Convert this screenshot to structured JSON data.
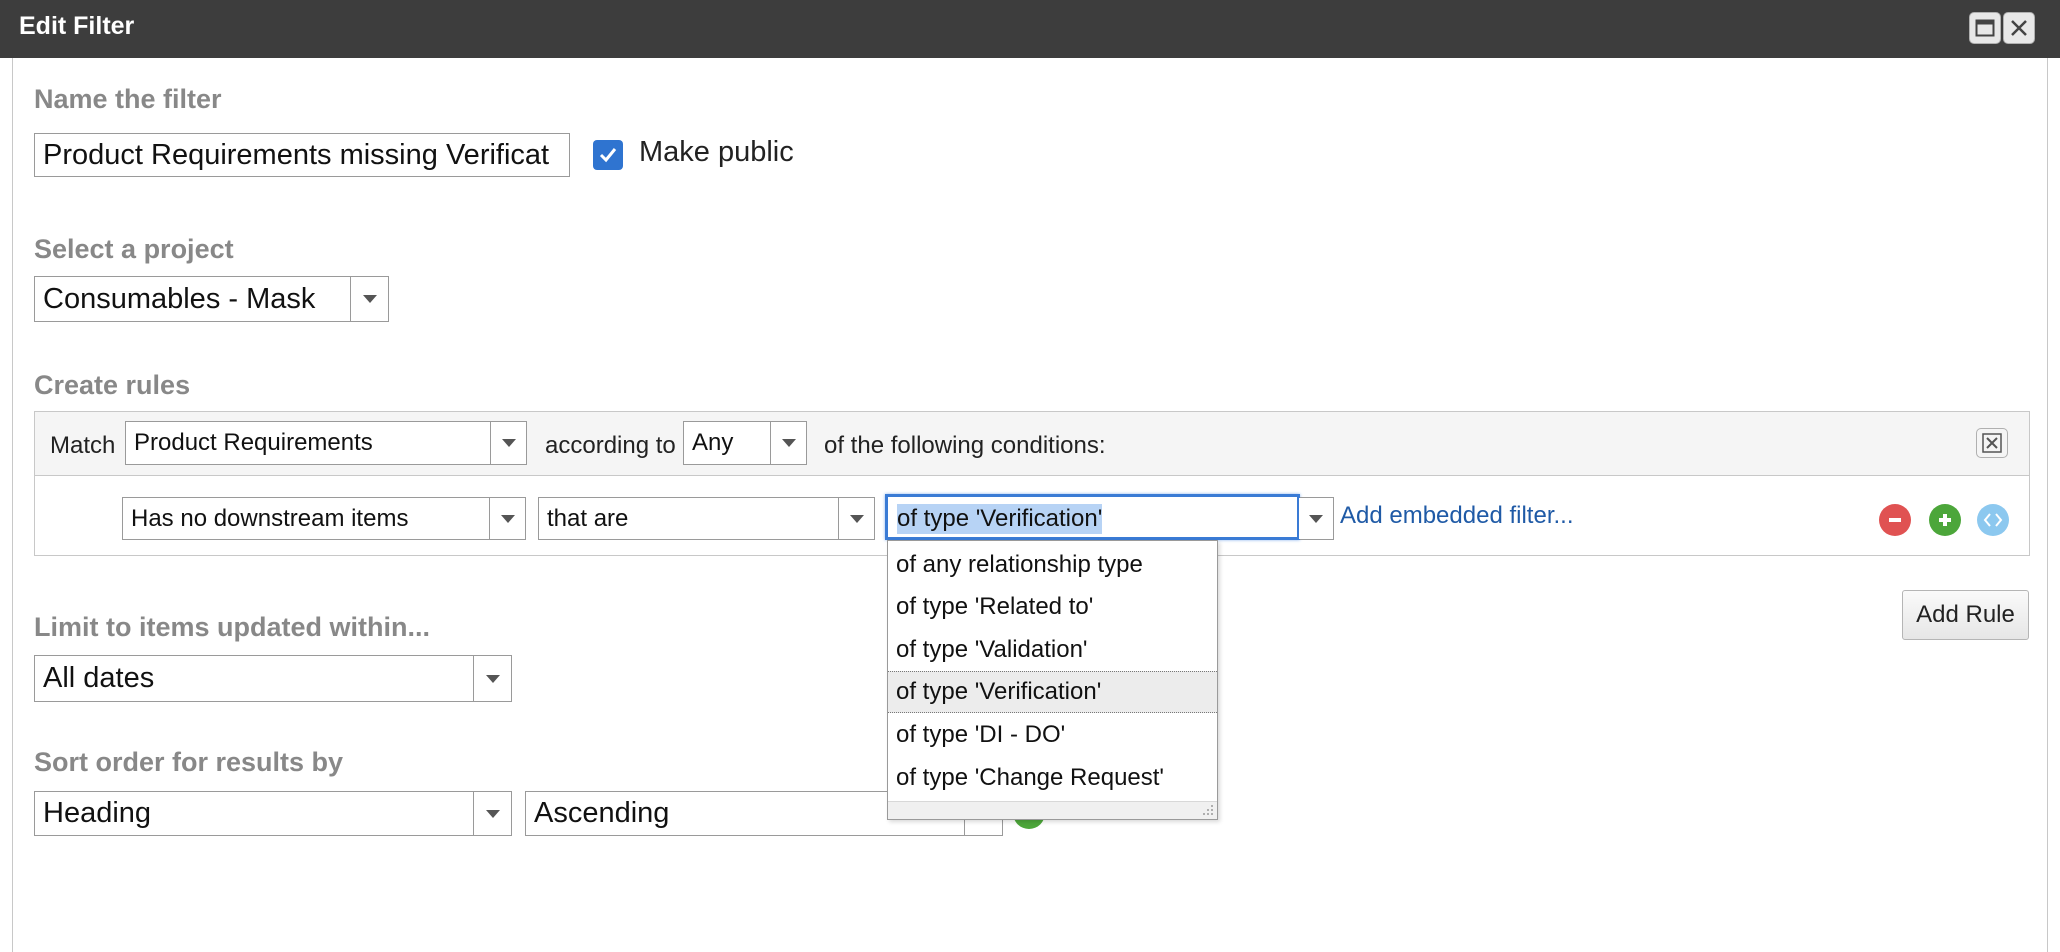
{
  "window": {
    "title": "Edit Filter"
  },
  "name_section": {
    "label": "Name the filter",
    "name_value": "Product Requirements missing Verificat",
    "make_public_label": "Make public",
    "make_public_checked": true
  },
  "project_section": {
    "label": "Select a project",
    "project_value": "Consumables - Mask"
  },
  "rules_section": {
    "label": "Create rules",
    "match_label": "Match",
    "match_value": "Product Requirements",
    "according_to_label": "according to",
    "according_value": "Any",
    "conditions_label": "of the following conditions:",
    "rule": {
      "condition_value": "Has no downstream items",
      "qualifier_value": "that are",
      "type_value": "of type 'Verification'",
      "add_embedded_filter_link": "Add embedded filter..."
    },
    "type_options": [
      "of any relationship type",
      "of type 'Related to'",
      "of type 'Validation'",
      "of type 'Verification'",
      "of type 'DI - DO'",
      "of type 'Change Request'"
    ],
    "selected_type_index": 3,
    "add_rule_label": "Add Rule"
  },
  "limit_section": {
    "label": "Limit to items updated within...",
    "value": "All dates"
  },
  "sort_section": {
    "label": "Sort order for results by",
    "field_value": "Heading",
    "direction_value": "Ascending"
  },
  "colors": {
    "titlebar_bg": "#3d3d3d",
    "section_label": "#888888",
    "link": "#1f5aa6",
    "checkbox": "#2f74d0",
    "remove_button": "#e05252",
    "add_button": "#4ca63a",
    "embed_button": "#8cc8ef",
    "focus_border": "#3a7bd5"
  }
}
